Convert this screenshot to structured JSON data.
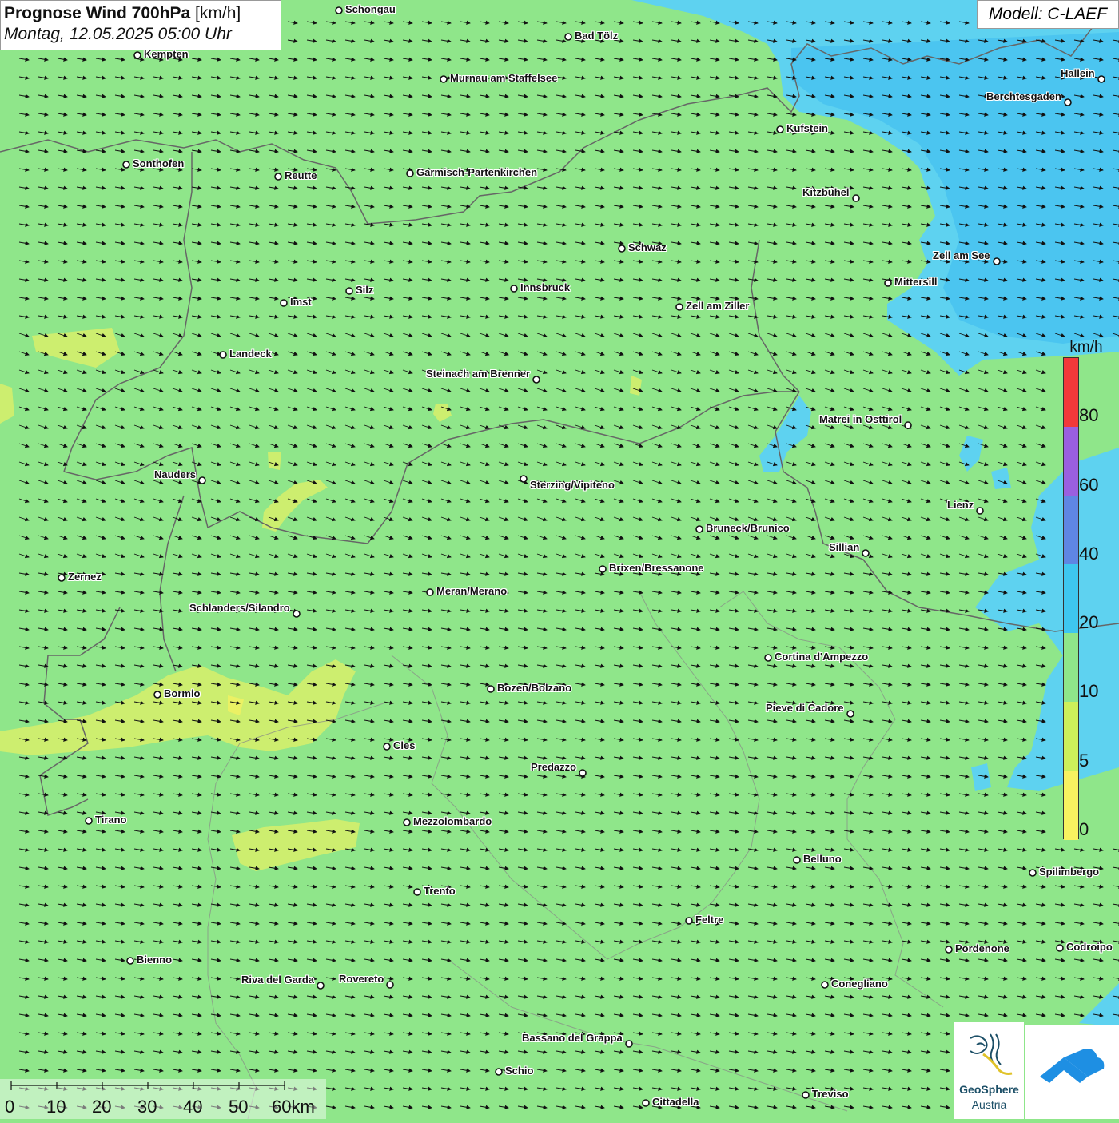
{
  "title": {
    "bold": "Prognose Wind 700hPa",
    "unit": "[km/h]",
    "date": "Montag, 12.05.2025 05:00 Uhr"
  },
  "model": "Modell: C-LAEF",
  "legend": {
    "unit": "km/h",
    "labels": [
      "80",
      "60",
      "40",
      "20",
      "10",
      "5",
      "0"
    ],
    "colors": {
      "0-5": "#f8f260",
      "5-10": "#cdf05a",
      "10-20": "#8fe68a",
      "20-40": "#3ec7ef",
      "40-60": "#5f86e3",
      "60-80": "#9a5fe0",
      "80+": "#f2393a"
    }
  },
  "wind_arrow_direction": "east-southeast",
  "cities": [
    {
      "name": "Schongau"
    },
    {
      "name": "Bad Tölz"
    },
    {
      "name": "Kempten"
    },
    {
      "name": "Murnau am Staffelsee"
    },
    {
      "name": "Hallein"
    },
    {
      "name": "Berchtesgaden"
    },
    {
      "name": "Kufstein"
    },
    {
      "name": "Sonthofen"
    },
    {
      "name": "Reutte"
    },
    {
      "name": "Garmisch-Partenkirchen"
    },
    {
      "name": "Kitzbühel"
    },
    {
      "name": "Schwaz"
    },
    {
      "name": "Zell am See"
    },
    {
      "name": "Innsbruck"
    },
    {
      "name": "Mittersill"
    },
    {
      "name": "Silz"
    },
    {
      "name": "Imst"
    },
    {
      "name": "Zell am Ziller"
    },
    {
      "name": "Landeck"
    },
    {
      "name": "Steinach am Brenner"
    },
    {
      "name": "Matrei in Osttirol"
    },
    {
      "name": "Nauders"
    },
    {
      "name": "Sterzing/Vipiteno"
    },
    {
      "name": "Lienz"
    },
    {
      "name": "Bruneck/Brunico"
    },
    {
      "name": "Sillian"
    },
    {
      "name": "Zernez"
    },
    {
      "name": "Brixen/Bressanone"
    },
    {
      "name": "Meran/Merano"
    },
    {
      "name": "Schlanders/Silandro"
    },
    {
      "name": "Cortina d'Ampezzo"
    },
    {
      "name": "Bozen/Bolzano"
    },
    {
      "name": "Bormio"
    },
    {
      "name": "Pieve di Cadore"
    },
    {
      "name": "Cles"
    },
    {
      "name": "Predazzo"
    },
    {
      "name": "Tirano"
    },
    {
      "name": "Mezzolombardo"
    },
    {
      "name": "Belluno"
    },
    {
      "name": "Spilimbergo"
    },
    {
      "name": "Trento"
    },
    {
      "name": "Feltre"
    },
    {
      "name": "Bienno"
    },
    {
      "name": "Pordenone"
    },
    {
      "name": "Codroipo"
    },
    {
      "name": "Riva del Garda"
    },
    {
      "name": "Rovereto"
    },
    {
      "name": "Conegliano"
    },
    {
      "name": "Bassano del Grappa"
    },
    {
      "name": "Schio"
    },
    {
      "name": "Treviso"
    },
    {
      "name": "Cittadella"
    }
  ],
  "scale": {
    "labels": [
      "0",
      "10",
      "20",
      "30",
      "40",
      "50",
      "60km"
    ]
  },
  "logo": {
    "line1": "GeoSphere",
    "line2": "Austria"
  }
}
